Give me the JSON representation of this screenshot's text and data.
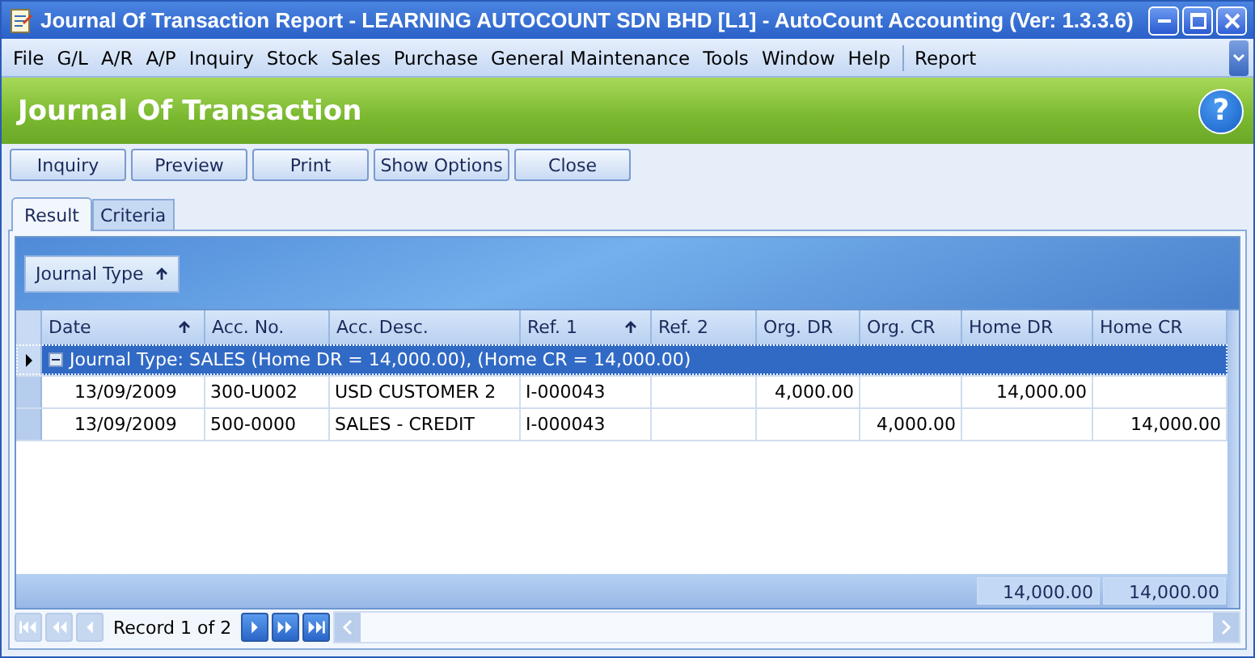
{
  "window": {
    "title": "Journal Of Transaction Report - LEARNING AUTOCOUNT SDN BHD [L1] - AutoCount Accounting (Ver: 1.3.3.6)"
  },
  "menu": [
    {
      "kind": "item",
      "label": "File"
    },
    {
      "kind": "item",
      "label": "G/L"
    },
    {
      "kind": "item",
      "label": "A/R"
    },
    {
      "kind": "item",
      "label": "A/P"
    },
    {
      "kind": "item",
      "label": "Inquiry"
    },
    {
      "kind": "item",
      "label": "Stock"
    },
    {
      "kind": "item",
      "label": "Sales"
    },
    {
      "kind": "item",
      "label": "Purchase"
    },
    {
      "kind": "item",
      "label": "General Maintenance"
    },
    {
      "kind": "item",
      "label": "Tools"
    },
    {
      "kind": "item",
      "label": "Window"
    },
    {
      "kind": "item",
      "label": "Help"
    },
    {
      "kind": "separator"
    },
    {
      "kind": "item",
      "label": "Report"
    }
  ],
  "header": {
    "title": "Journal Of Transaction",
    "help": "?"
  },
  "buttons": [
    "Inquiry",
    "Preview",
    "Print",
    "Show Options",
    "Close"
  ],
  "tabs": [
    {
      "label": "Result",
      "selected": true
    },
    {
      "label": "Criteria",
      "selected": false
    }
  ],
  "group_by": {
    "label": "Journal Type",
    "sorted": true
  },
  "table": {
    "columns": [
      {
        "label": "Date",
        "sorted": true,
        "kind": "text"
      },
      {
        "label": "Acc. No.",
        "sorted": false,
        "kind": "text"
      },
      {
        "label": "Acc. Desc.",
        "sorted": false,
        "kind": "text"
      },
      {
        "label": "Ref. 1",
        "sorted": true,
        "kind": "text"
      },
      {
        "label": "Ref. 2",
        "sorted": false,
        "kind": "text"
      },
      {
        "label": "Org. DR",
        "sorted": false,
        "kind": "amount"
      },
      {
        "label": "Org. CR",
        "sorted": false,
        "kind": "amount"
      },
      {
        "label": "Home DR",
        "sorted": false,
        "kind": "amount"
      },
      {
        "label": "Home CR",
        "sorted": false,
        "kind": "amount"
      }
    ],
    "group": {
      "label": "Journal Type: SALES (Home DR = 14,000.00), (Home CR = 14,000.00)",
      "selected": true,
      "expanded": true
    },
    "rows": [
      {
        "selected": false,
        "cells": [
          "13/09/2009",
          "300-U002",
          "USD CUSTOMER 2",
          "I-000043",
          "",
          "4,000.00",
          "",
          "14,000.00",
          ""
        ]
      },
      {
        "selected": false,
        "cells": [
          "13/09/2009",
          "500-0000",
          "SALES - CREDIT",
          "I-000043",
          "",
          "",
          "4,000.00",
          "",
          "14,000.00"
        ]
      }
    ],
    "totals": [
      "14,000.00",
      "14,000.00"
    ]
  },
  "navigator": {
    "record": "Record 1 of 2",
    "buttons": [
      {
        "kind": "first",
        "disabled": true
      },
      {
        "kind": "prev_page",
        "disabled": true
      },
      {
        "kind": "prev",
        "disabled": true
      },
      {
        "kind": "next",
        "disabled": false
      },
      {
        "kind": "next_page",
        "disabled": false
      },
      {
        "kind": "last",
        "disabled": false
      }
    ]
  }
}
